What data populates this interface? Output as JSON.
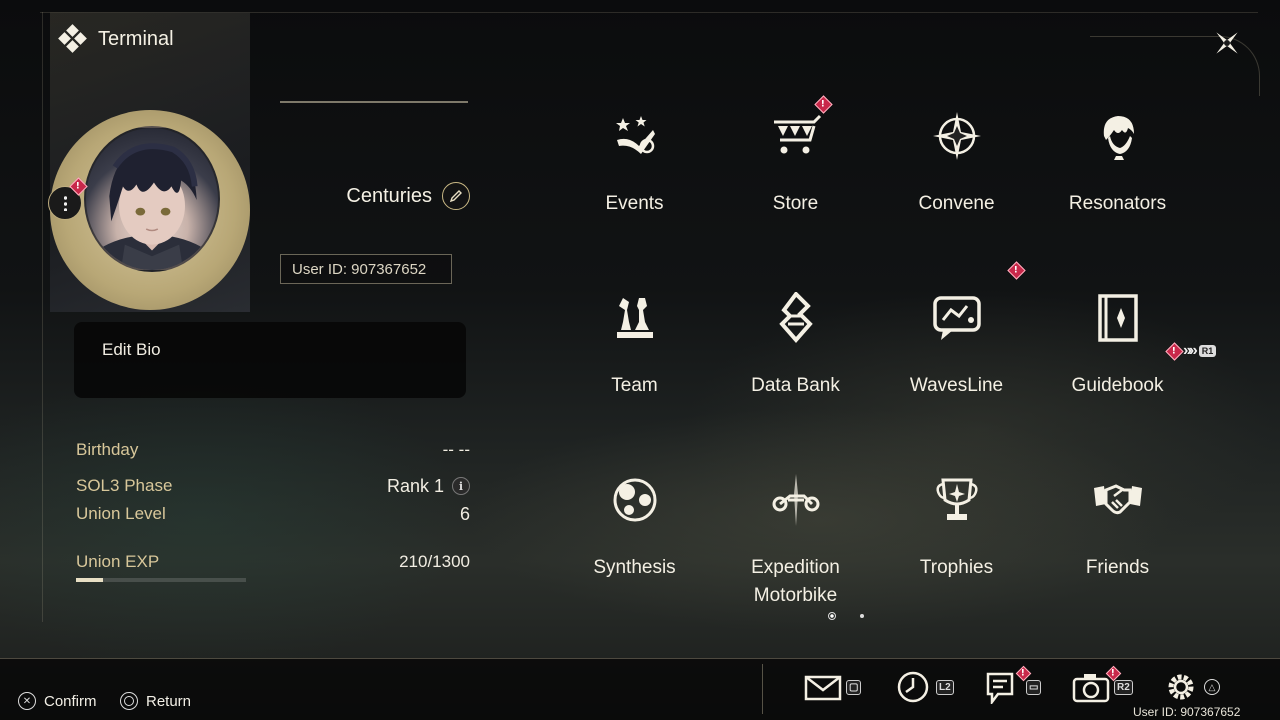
{
  "header": {
    "title": "Terminal"
  },
  "profile": {
    "name": "Centuries",
    "user_id_label": "User ID: 907367652",
    "bio_label": "Edit Bio"
  },
  "stats": {
    "birthday_label": "Birthday",
    "birthday_value": "-- --",
    "sol3_label": "SOL3 Phase",
    "sol3_value": "Rank 1",
    "union_level_label": "Union Level",
    "union_level_value": "6",
    "union_exp_label": "Union EXP",
    "union_exp_value": "210/1300",
    "union_exp_fraction": 0.1615
  },
  "menu": {
    "items": [
      {
        "label": "Events",
        "icon": "events-icon",
        "alert": false
      },
      {
        "label": "Store",
        "icon": "store-cart-icon",
        "alert": true
      },
      {
        "label": "Convene",
        "icon": "convene-star-icon",
        "alert": false
      },
      {
        "label": "Resonators",
        "icon": "resonator-portrait-icon",
        "alert": false
      },
      {
        "label": "Team",
        "icon": "team-chess-icon",
        "alert": false
      },
      {
        "label": "Data Bank",
        "icon": "data-bank-icon",
        "alert": false
      },
      {
        "label": "WavesLine",
        "icon": "wavesline-chat-icon",
        "alert": true
      },
      {
        "label": "Guidebook",
        "icon": "guidebook-book-icon",
        "alert": false
      },
      {
        "label": "Synthesis",
        "icon": "synthesis-icon",
        "alert": false
      },
      {
        "label": "Expedition\nMotorbike",
        "icon": "motorbike-icon",
        "alert": false
      },
      {
        "label": "Trophies",
        "icon": "trophy-icon",
        "alert": false
      },
      {
        "label": "Friends",
        "icon": "handshake-icon",
        "alert": false
      }
    ],
    "guidebook_key": "R1"
  },
  "bottom": {
    "confirm_label": "Confirm",
    "return_label": "Return",
    "mail_key": "",
    "time_key": "L2",
    "quest_key": "",
    "camera_key": "R2",
    "user_id_label": "User ID: 907367652"
  },
  "colors": {
    "accent_gold": "#d8c79a",
    "alert_red": "#c8284a",
    "text": "#f4f0e4"
  }
}
